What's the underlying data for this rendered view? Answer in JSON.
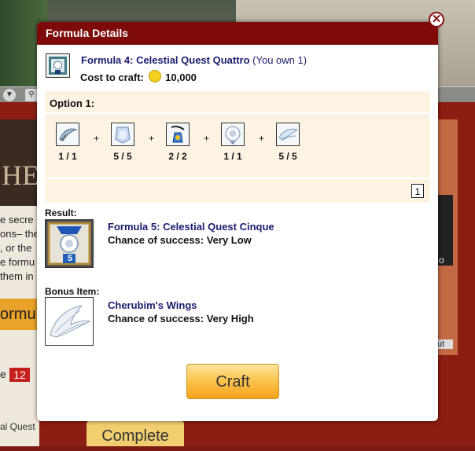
{
  "background": {
    "left_texts": [
      "e secre",
      "ons– the",
      ", or the",
      "e formu",
      "them in"
    ],
    "formula_button": "ormula",
    "badge_label": "e",
    "badge_count": "12",
    "quest_label": "al Quest",
    "complete_button": "Complete",
    "right_o": "o",
    "right_ut": "ut"
  },
  "dialog": {
    "title": "Formula Details",
    "close_symbol": "✕",
    "formula_name": "Formula 4: Celestial Quest Quattro",
    "owned_text": "(You own 1)",
    "cost_label": "Cost to craft:",
    "cost_value": "10,000",
    "option": {
      "title": "Option 1:",
      "ingredients": [
        {
          "icon": "feather-icon",
          "count": "1 / 1"
        },
        {
          "icon": "crystal-icon",
          "count": "5 / 5"
        },
        {
          "icon": "potion-icon",
          "count": "2 / 2"
        },
        {
          "icon": "orb-icon",
          "count": "1 / 1"
        },
        {
          "icon": "wing-icon",
          "count": "5 / 5"
        }
      ],
      "plus_symbol": "+",
      "page": "1"
    },
    "result": {
      "label": "Result:",
      "name": "Formula 5: Celestial Quest Cinque",
      "chance": "Chance of success: Very Low",
      "icon_number": "5"
    },
    "bonus": {
      "label": "Bonus Item:",
      "name": "Cherubim's Wings",
      "chance": "Chance of success: Very High"
    },
    "craft_button": "Craft"
  }
}
